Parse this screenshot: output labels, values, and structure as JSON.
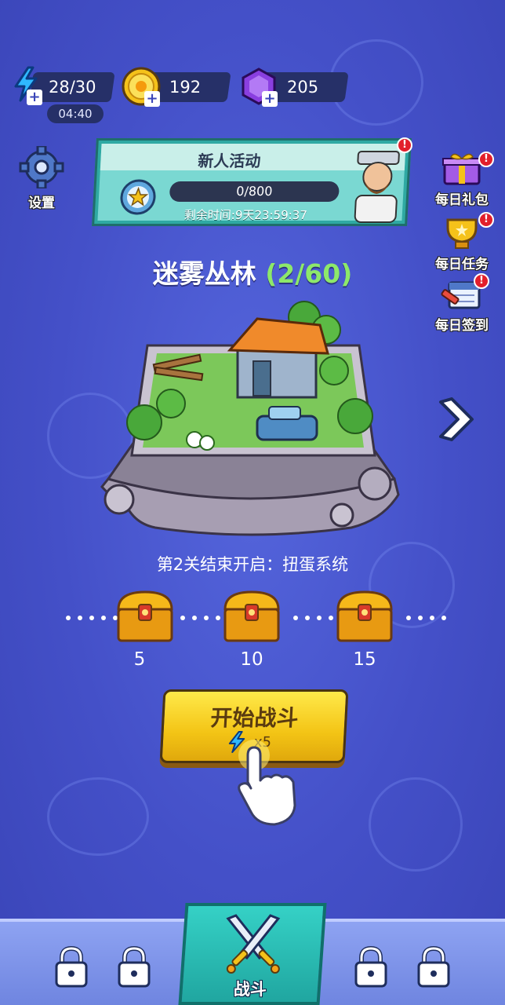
{
  "top_bar": {
    "energy": {
      "value": "28/30",
      "timer": "04:40",
      "icon": "lightning-icon"
    },
    "coins": {
      "value": "192",
      "icon": "sun-coin-icon"
    },
    "gems": {
      "value": "205",
      "icon": "purple-gem-icon"
    }
  },
  "settings": {
    "label": "设置",
    "icon": "gear-icon"
  },
  "event": {
    "title": "新人活动",
    "progress": "0/800",
    "remaining": "剩余时间:9天23:59:37",
    "badge": "!"
  },
  "side_menu": [
    {
      "label": "每日礼包",
      "icon": "gift-icon",
      "badge": "!"
    },
    {
      "label": "每日任务",
      "icon": "trophy-icon",
      "badge": "!"
    },
    {
      "label": "每日签到",
      "icon": "calendar-icon",
      "badge": "!"
    }
  ],
  "level": {
    "name": "迷雾丛林",
    "count": "(2/60)"
  },
  "unlock_text": "第2关结束开启：扭蛋系统",
  "chests": [
    {
      "threshold": "5"
    },
    {
      "threshold": "10"
    },
    {
      "threshold": "15"
    }
  ],
  "battle_button": {
    "label": "开始战斗",
    "cost": "x5"
  },
  "bottom_nav": {
    "battle_label": "战斗"
  },
  "colors": {
    "background": "#4450c8",
    "accent_yellow": "#f3c415",
    "accent_teal": "#2fa9a3",
    "badge_red": "#e21f2b"
  }
}
